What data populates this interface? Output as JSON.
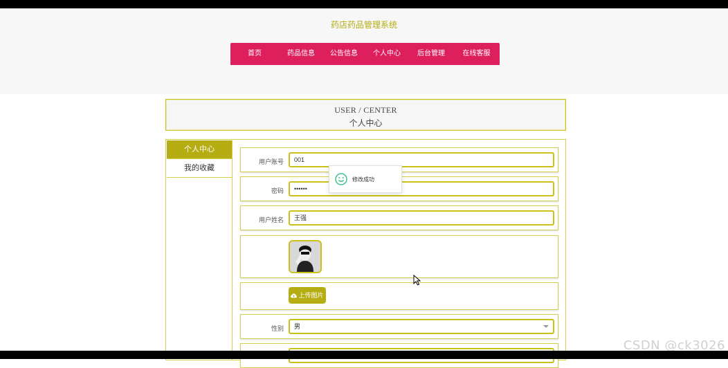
{
  "site": {
    "title": "药店药品管理系统"
  },
  "nav": {
    "items": [
      "首页",
      "药品信息",
      "公告信息",
      "个人中心",
      "后台管理",
      "在线客服"
    ]
  },
  "section": {
    "title_en": "USER / CENTER",
    "title_zh": "个人中心"
  },
  "sidebar": {
    "items": [
      {
        "label": "个人中心",
        "active": true
      },
      {
        "label": "我的收藏",
        "active": false
      }
    ]
  },
  "form": {
    "account": {
      "label": "用户账号",
      "value": "001"
    },
    "password": {
      "label": "密码",
      "value": "••••••"
    },
    "name": {
      "label": "用户姓名",
      "value": "王强"
    },
    "upload_label": "上传图片",
    "gender": {
      "label": "性别",
      "value": "男"
    }
  },
  "toast": {
    "message": "修改成功"
  },
  "watermark": "CSDN @ck3026",
  "colors": {
    "accent": "#b5ad12",
    "nav_bg": "#dd1f5e",
    "border": "#c9c118"
  }
}
